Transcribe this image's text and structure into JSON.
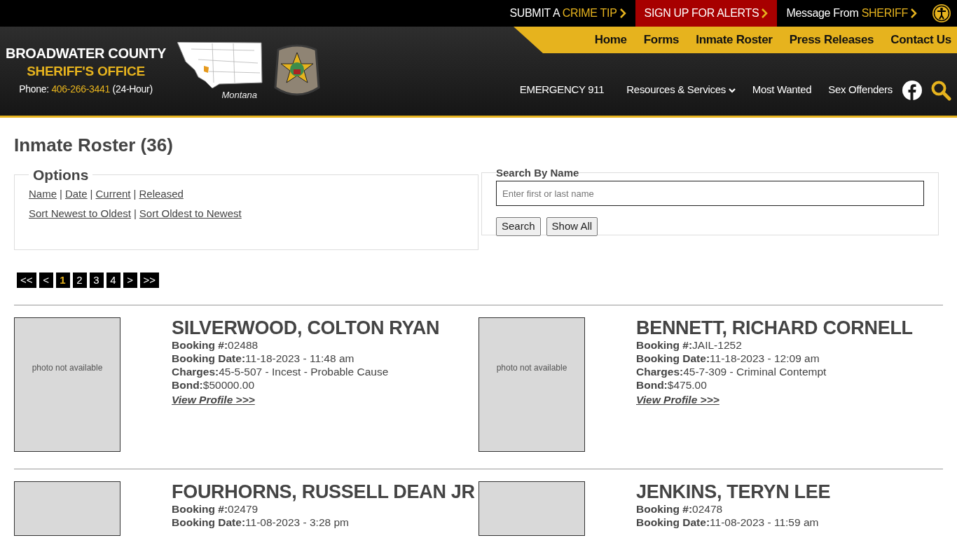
{
  "top_bar": {
    "links": [
      {
        "kind": "plain",
        "text": "SUBMIT A ",
        "accent": "CRIME TIP"
      },
      {
        "kind": "alert",
        "text": "SIGN UP FOR ALERTS"
      },
      {
        "kind": "plain",
        "text": "Message From ",
        "accent": "SHERIFF"
      }
    ]
  },
  "brand": {
    "title": "BROADWATER COUNTY",
    "subtitle": "SHERIFF'S OFFICE",
    "phone_label": "Phone: ",
    "phone": "406-266-3441",
    "phone_note": " (24-Hour)",
    "map_caption": "Montana"
  },
  "main_nav": [
    "Home",
    "Forms",
    "Inmate Roster",
    "Press Releases",
    "Contact Us"
  ],
  "sub_nav": {
    "emergency": "EMERGENCY ",
    "emergency_number": "911",
    "items": [
      {
        "label": "Resources & Services",
        "dropdown": true
      },
      {
        "label": "Most Wanted",
        "dropdown": false
      },
      {
        "label": "Sex Offenders",
        "dropdown": false
      }
    ]
  },
  "page_title": "Inmate Roster (36)",
  "options": {
    "legend": "Options",
    "lines": [
      {
        "items": [
          {
            "kind": "link",
            "text": "Name"
          },
          {
            "kind": "separator",
            "text": "|"
          },
          {
            "kind": "link",
            "text": "Date"
          },
          {
            "kind": "separator",
            "text": "|"
          },
          {
            "kind": "link",
            "text": "Current"
          },
          {
            "kind": "separator",
            "text": "|"
          },
          {
            "kind": "link",
            "text": "Released"
          }
        ]
      },
      {
        "items": [
          {
            "kind": "link",
            "text": "Sort Newest to Oldest"
          },
          {
            "kind": "separator",
            "text": "|"
          },
          {
            "kind": "link",
            "text": "Sort Oldest to Newest"
          }
        ]
      }
    ]
  },
  "search": {
    "legend": "Search By Name",
    "placeholder": "Enter first or last name",
    "buttons": [
      "Search",
      "Show All"
    ]
  },
  "pagination": [
    {
      "label": "<<",
      "selected": false
    },
    {
      "label": "<",
      "selected": false
    },
    {
      "label": "1",
      "selected": true
    },
    {
      "label": "2",
      "selected": false
    },
    {
      "label": "3",
      "selected": false
    },
    {
      "label": "4",
      "selected": false
    },
    {
      "label": ">",
      "selected": false
    },
    {
      "label": ">>",
      "selected": false
    }
  ],
  "inmates": [
    {
      "name": "SILVERWOOD, COLTON RYAN",
      "photo_text": "photo not available",
      "fields": [
        {
          "label": "Booking #:",
          "value": "02488"
        },
        {
          "label": "Booking Date:",
          "value": "11-18-2023 - 11:48 am"
        },
        {
          "label": "Charges:",
          "value": "45-5-507 - Incest - Probable Cause"
        },
        {
          "label": "Bond:",
          "value": "$50000.00"
        }
      ],
      "link": "View Profile >>>"
    },
    {
      "name": "BENNETT, RICHARD CORNELL",
      "photo_text": "photo not available",
      "fields": [
        {
          "label": "Booking #:",
          "value": "JAIL-1252"
        },
        {
          "label": "Booking Date:",
          "value": "11-18-2023 - 12:09 am"
        },
        {
          "label": "Charges:",
          "value": "45-7-309 - Criminal Contempt"
        },
        {
          "label": "Bond:",
          "value": "$475.00"
        }
      ],
      "link": "View Profile >>>"
    },
    {
      "name": "FOURHORNS, RUSSELL DEAN JR",
      "fields": [
        {
          "label": "Booking #:",
          "value": "02479"
        },
        {
          "label": "Booking Date:",
          "value": "11-08-2023 - 3:28 pm"
        }
      ]
    },
    {
      "name": "JENKINS, TERYN LEE",
      "fields": [
        {
          "label": "Booking #:",
          "value": "02478"
        },
        {
          "label": "Booking Date:",
          "value": "11-08-2023 - 11:59 am"
        }
      ]
    }
  ]
}
